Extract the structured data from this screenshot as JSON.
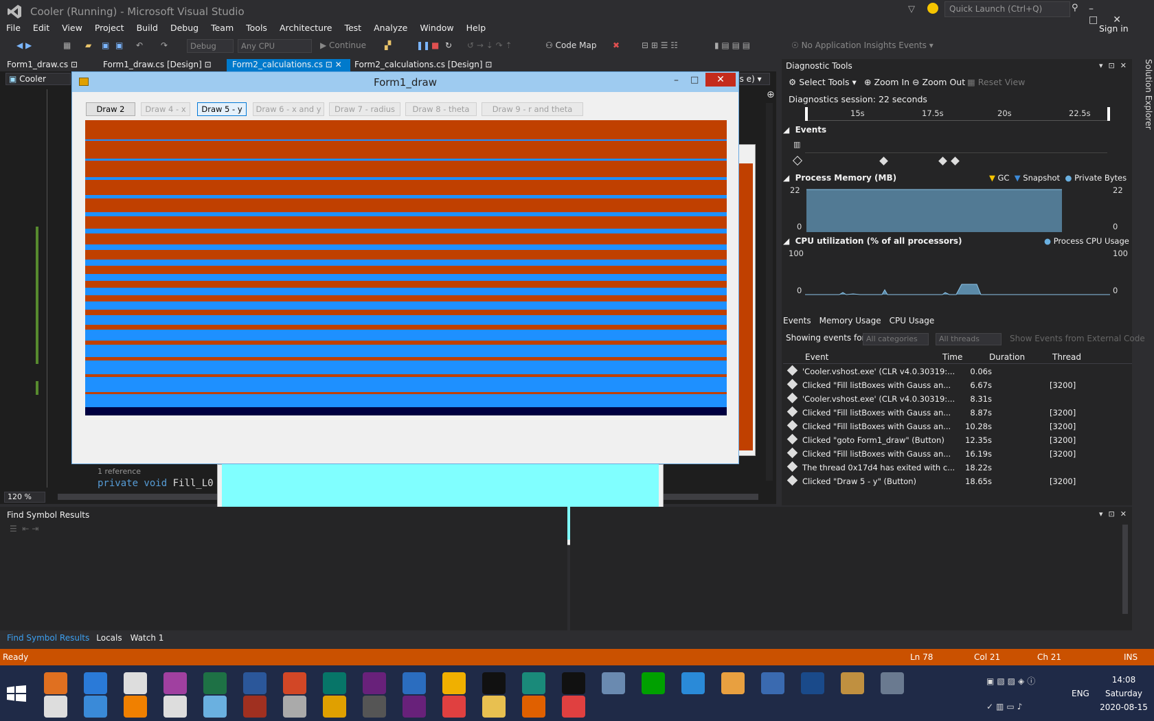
{
  "window": {
    "title": "Cooler (Running) - Microsoft Visual Studio"
  },
  "menu": [
    "File",
    "Edit",
    "View",
    "Project",
    "Build",
    "Debug",
    "Team",
    "Tools",
    "Architecture",
    "Test",
    "Analyze",
    "Window",
    "Help"
  ],
  "quick_launch": "Quick Launch (Ctrl+Q)",
  "sign_in": "Sign in",
  "toolbar": {
    "config": "Debug",
    "platform": "Any CPU",
    "continue": "Continue",
    "code_map": "Code Map",
    "insights": "No Application Insights Events"
  },
  "tabs": [
    {
      "label": "Form1_draw.cs"
    },
    {
      "label": "Form1_draw.cs [Design]"
    },
    {
      "label": "Form2_calculations.cs",
      "active": true
    },
    {
      "label": "Form2_calculations.cs [Design]"
    }
  ],
  "editor": {
    "nav_project": "Cooler",
    "reference_hint": "1 reference",
    "code_kw": "private void",
    "code_rest": " Fill_L0",
    "zoom": "120 %",
    "partial_right": "gs e)"
  },
  "form": {
    "title": "Form1_draw",
    "buttons": [
      {
        "label": "Draw 2",
        "state": "normal"
      },
      {
        "label": "Draw 4 - x",
        "state": "disabled"
      },
      {
        "label": "Draw 5 - y",
        "state": "focused"
      },
      {
        "label": "Draw 6 - x and y",
        "state": "disabled"
      },
      {
        "label": "Draw 7 - radius",
        "state": "disabled"
      },
      {
        "label": "Draw 8 - theta",
        "state": "disabled"
      },
      {
        "label": "Draw 9 - r and theta",
        "state": "disabled"
      }
    ],
    "colors": {
      "orange": "#c04000",
      "blue": "#1e90ff",
      "navy": "#000040"
    }
  },
  "diagnostics": {
    "title": "Diagnostic Tools",
    "select_tools": "Select Tools",
    "zoom_in": "Zoom In",
    "zoom_out": "Zoom Out",
    "reset_view": "Reset View",
    "session": "Diagnostics session: 22 seconds",
    "ticks": [
      "15s",
      "17.5s",
      "20s",
      "22.5s"
    ],
    "events_label": "Events",
    "memory_label": "Process Memory (MB)",
    "memory_legend": [
      "GC",
      "Snapshot",
      "Private Bytes"
    ],
    "memory_max": "22",
    "memory_min": "0",
    "cpu_label": "CPU utilization (% of all processors)",
    "cpu_legend": "Process CPU Usage",
    "cpu_max": "100",
    "cpu_min": "0",
    "bottom_tabs": [
      "Events",
      "Memory Usage",
      "CPU Usage"
    ],
    "showing_for": "Showing events for:",
    "all_categories": "All categories",
    "all_threads": "All threads",
    "show_external": "Show Events from External Code",
    "columns": [
      "Event",
      "Time",
      "Duration",
      "Thread"
    ],
    "events": [
      {
        "event": "'Cooler.vshost.exe' (CLR v4.0.30319:...",
        "time": "0.06s",
        "thread": ""
      },
      {
        "event": "Clicked \"Fill listBoxes with Gauss an...",
        "time": "6.67s",
        "thread": "[3200]"
      },
      {
        "event": "'Cooler.vshost.exe' (CLR v4.0.30319:...",
        "time": "8.31s",
        "thread": ""
      },
      {
        "event": "Clicked \"Fill listBoxes with Gauss an...",
        "time": "8.87s",
        "thread": "[3200]"
      },
      {
        "event": "Clicked \"Fill listBoxes with Gauss an...",
        "time": "10.28s",
        "thread": "[3200]"
      },
      {
        "event": "Clicked \"goto Form1_draw\" (Button)",
        "time": "12.35s",
        "thread": "[3200]"
      },
      {
        "event": "Clicked \"Fill listBoxes with Gauss an...",
        "time": "16.19s",
        "thread": "[3200]"
      },
      {
        "event": "The thread 0x17d4 has exited with c...",
        "time": "18.22s",
        "thread": ""
      },
      {
        "event": "Clicked \"Draw 5 - y\" (Button)",
        "time": "18.65s",
        "thread": "[3200]"
      }
    ]
  },
  "find_panel": {
    "title": "Find Symbol Results"
  },
  "panel_tabs": [
    "Find Symbol Results",
    "Locals",
    "Watch 1"
  ],
  "status": {
    "ready": "Ready",
    "ln": "Ln 78",
    "col": "Col 21",
    "ch": "Ch 21",
    "ins": "INS"
  },
  "taskbar": {
    "lang": "ENG",
    "time": "14:08",
    "day": "Saturday",
    "date": "2020-08-15"
  },
  "solution_explorer": "Solution Explorer"
}
